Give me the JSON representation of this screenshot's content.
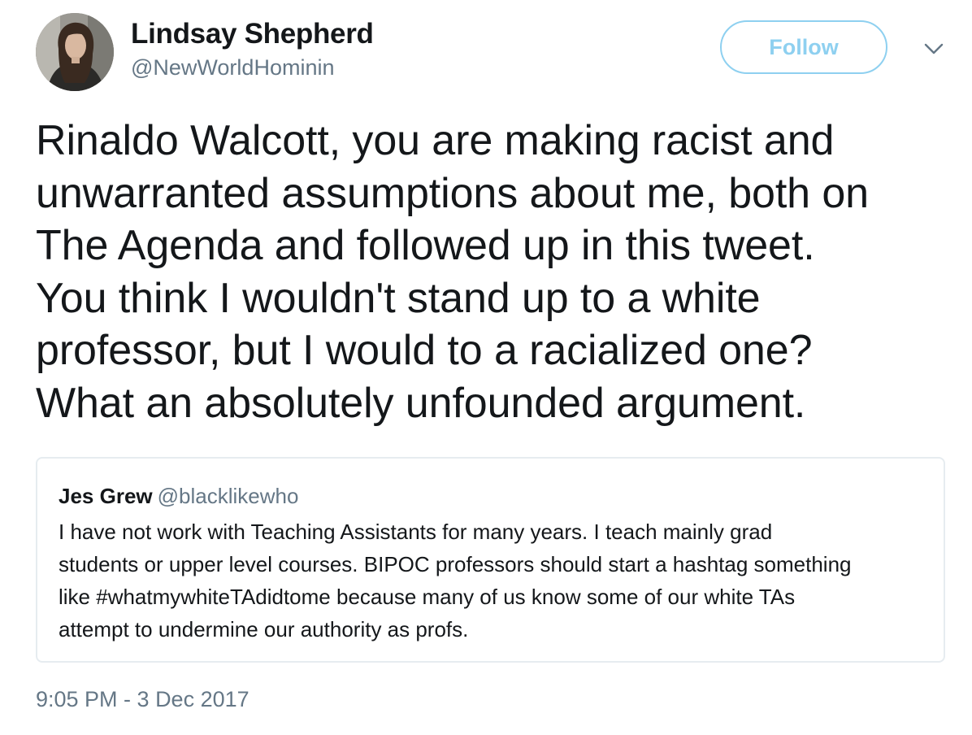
{
  "tweet": {
    "author": {
      "name": "Lindsay Shepherd",
      "handle": "@NewWorldHominin"
    },
    "follow_label": "Follow",
    "text_lines": [
      "Rinaldo Walcott, you are making racist and",
      "unwarranted assumptions about me, both on",
      "The Agenda and followed up in this tweet.",
      "You think I wouldn't stand up to a white",
      "professor, but I would to a racialized one?",
      "What an absolutely unfounded argument."
    ],
    "quoted": {
      "name": "Jes Grew",
      "handle": "@blacklikewho",
      "text_lines": [
        "I have not work with Teaching Assistants for many years. I teach mainly grad",
        "students or upper level courses. BIPOC professors should start a hashtag something",
        "like #whatmywhiteTAdidtome because many of us know some of our white TAs",
        "attempt to undermine our authority as profs."
      ]
    },
    "timestamp": "9:05 PM - 3 Dec 2017",
    "icons": {
      "avatar": "profile-photo",
      "menu": "chevron-down-icon"
    },
    "colors": {
      "text": "#14171a",
      "secondary": "#657786",
      "follow_accent": "#8ed0f0",
      "card_border": "#e6ecf0"
    }
  }
}
